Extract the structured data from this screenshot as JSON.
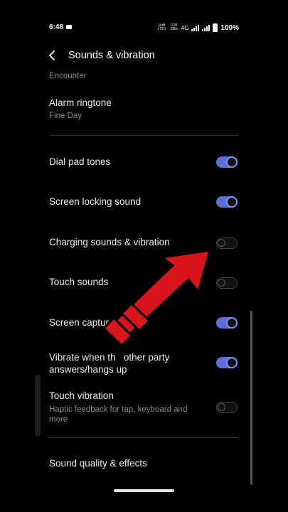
{
  "status_bar": {
    "time": "6:48",
    "volte": "VoB LTE1",
    "speed": "0.32 KB/s",
    "network": "4G",
    "battery": "100%"
  },
  "header": {
    "title": "Sounds & vibration"
  },
  "items": [
    {
      "title": "",
      "subtitle": "Encounter"
    },
    {
      "title": "Alarm ringtone",
      "subtitle": "Fine Day"
    },
    {
      "title": "Dial pad tones",
      "toggle": "on"
    },
    {
      "title": "Screen locking sound",
      "toggle": "on"
    },
    {
      "title": "Charging sounds & vibration",
      "toggle": "off"
    },
    {
      "title": "Touch sounds",
      "toggle": "off"
    },
    {
      "title": "Screen capture to",
      "toggle": "on"
    },
    {
      "title": "Vibrate when th   other party",
      "title2": "answers/hangs up",
      "toggle": "on"
    },
    {
      "title": "Touch vibration",
      "subtitle": "Haptic feedback for tap, keyboard and more",
      "toggle": "off"
    },
    {
      "title": "Sound quality & effects"
    }
  ],
  "colors": {
    "accent": "#5b6fd6",
    "arrow": "#d8141c",
    "background": "#000000"
  },
  "icons": {
    "back": "chevron-left-icon",
    "arrow": "red-arrow-annotation"
  }
}
